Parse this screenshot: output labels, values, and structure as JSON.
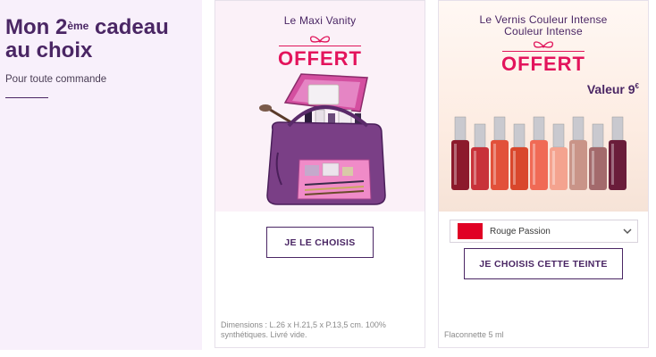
{
  "intro": {
    "title_pre": "Mon 2",
    "title_sup": "ème",
    "title_post": " cadeau au choix",
    "subtitle": "Pour toute commande"
  },
  "gifts": [
    {
      "title": "Le Maxi Vanity",
      "badge": "OFFERT",
      "button_label": "JE LE CHOISIS",
      "description": "Dimensions : L.26 x H.21,5 x P.13,5 cm. 100% synthétiques. Livré vide."
    },
    {
      "title_line1": "Le Vernis Couleur Intense",
      "title_line2": "Couleur Intense",
      "badge": "OFFERT",
      "value_label": "Valeur 9",
      "value_currency": "€",
      "selected_shade": "Rouge Passion",
      "selected_shade_color": "#e00024",
      "button_label": "JE CHOISIS CETTE TEINTE",
      "description": "Flaconnette 5 ml"
    }
  ],
  "colors": {
    "brand_purple": "#4a2664",
    "offert_pink": "#e3145c",
    "panel_bg": "#f8f0fb"
  },
  "polish_colors": [
    "#8c1a2c",
    "#c8323a",
    "#e2513a",
    "#d9472c",
    "#f06a55",
    "#f4a38f",
    "#c99488",
    "#a36a6c",
    "#6a1d3a"
  ],
  "icons": [
    "bow-icon",
    "chevron-down-icon",
    "vanity-bag-illustration",
    "nail-polish-illustration"
  ]
}
